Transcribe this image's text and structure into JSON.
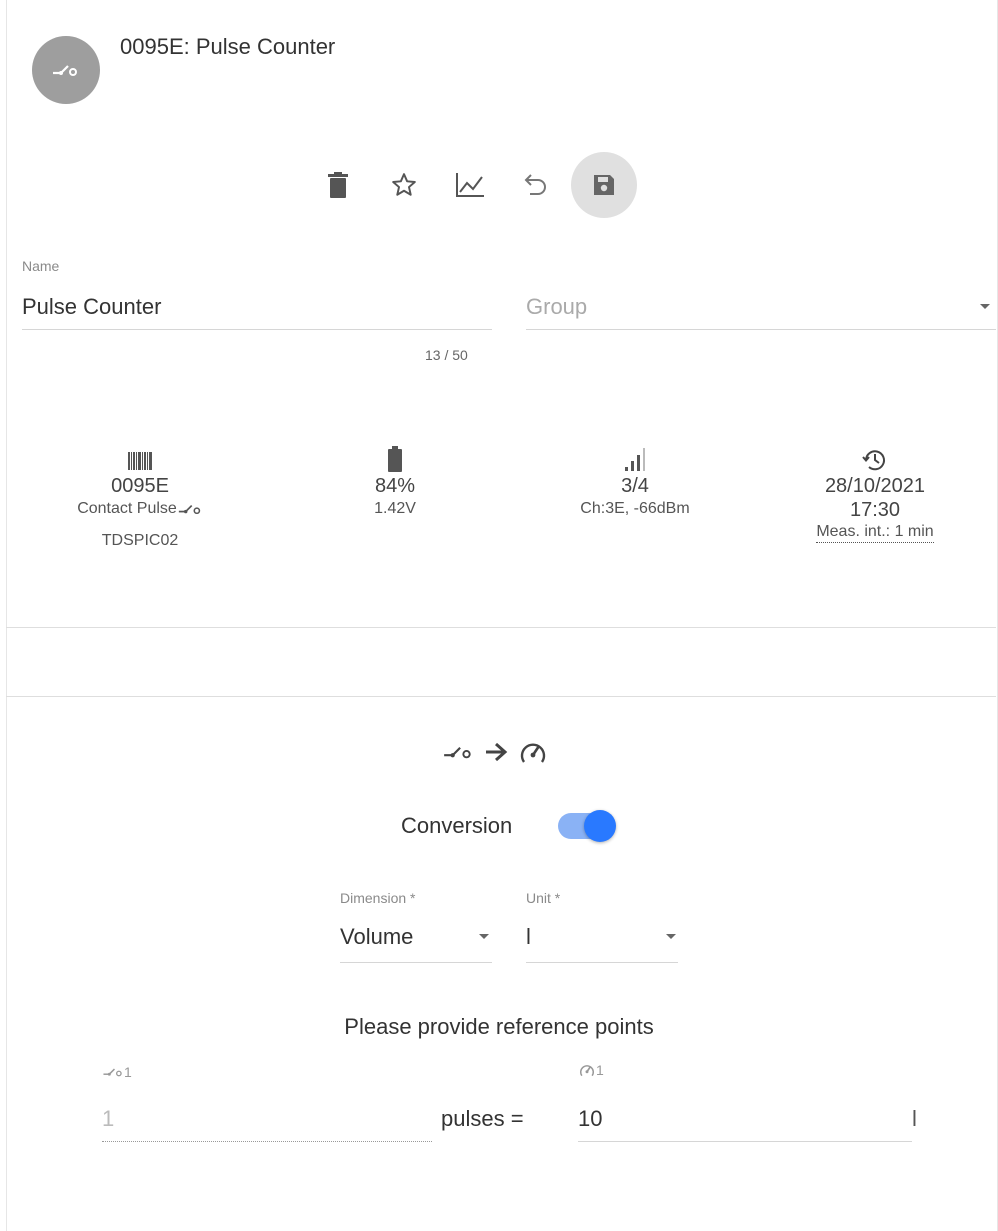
{
  "header": {
    "title": "0095E: Pulse Counter",
    "avatar_icon": "contact-switch-icon"
  },
  "toolbar": {
    "delete_icon": "trash-icon",
    "favorite_icon": "star-icon",
    "chart_icon": "chart-line-icon",
    "undo_icon": "undo-icon",
    "save_icon": "save-icon"
  },
  "name_field": {
    "label": "Name",
    "value": "Pulse Counter",
    "counter": "13 / 50"
  },
  "group_field": {
    "placeholder": "Group"
  },
  "device_info": {
    "serial": {
      "icon": "barcode-icon",
      "value": "0095E",
      "type": "Contact Pulse",
      "model": "TDSPIC02"
    },
    "battery": {
      "icon": "battery-icon",
      "percent": "84%",
      "voltage": "1.42V"
    },
    "signal": {
      "icon": "signal-icon",
      "value": "3/4",
      "detail": "Ch:3E, -66dBm"
    },
    "last_seen": {
      "icon": "history-icon",
      "date": "28/10/2021",
      "time": "17:30",
      "interval": "Meas. int.: 1 min"
    }
  },
  "conversion": {
    "label": "Conversion",
    "enabled": true,
    "dimension": {
      "label": "Dimension *",
      "value": "Volume"
    },
    "unit": {
      "label": "Unit *",
      "value": "l"
    },
    "reference_prompt": "Please provide reference points",
    "pulse_label_suffix": "1",
    "meter_label_suffix": "1",
    "pulse_value": "1",
    "pulses_text": "pulses =",
    "meter_value": "10",
    "unit_suffix": "l"
  },
  "colors": {
    "accent": "#2979ff",
    "avatar": "#9e9e9e"
  }
}
